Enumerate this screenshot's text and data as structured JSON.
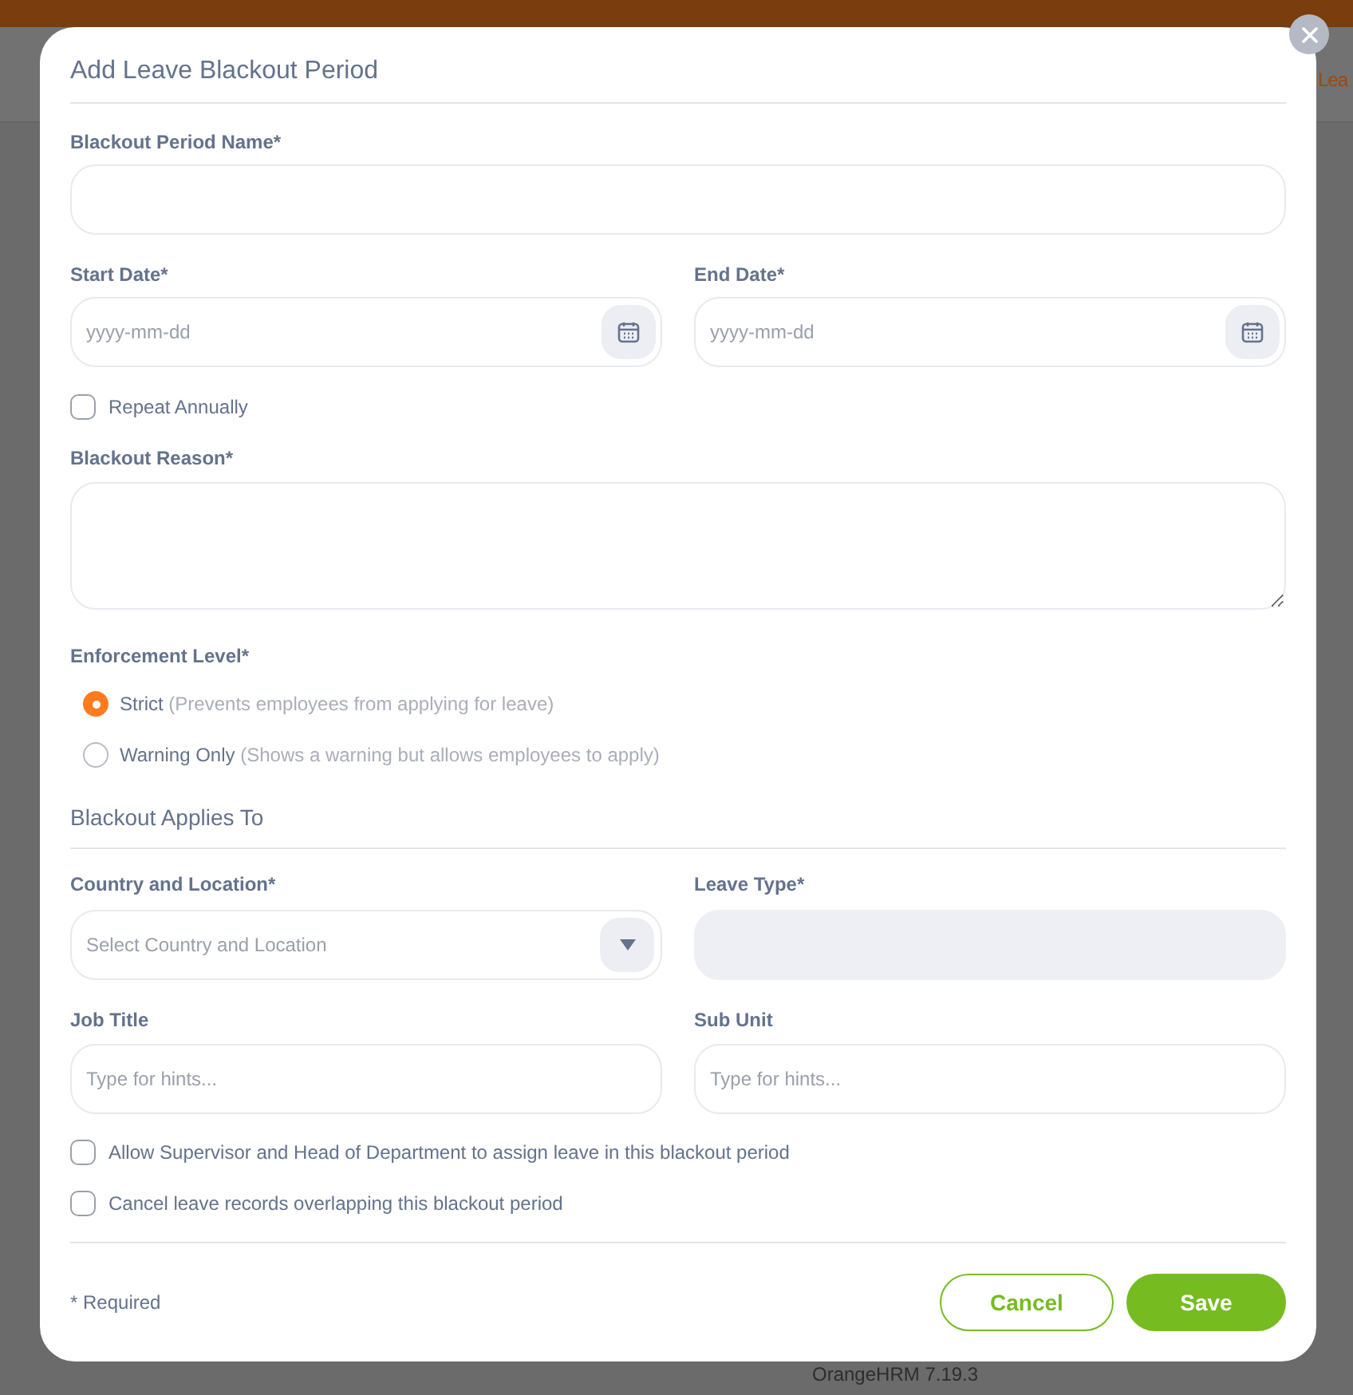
{
  "background": {
    "header_link": "Lea",
    "footer": "OrangeHRM 7.19.3"
  },
  "dialog": {
    "title": "Add Leave Blackout Period",
    "name_field": {
      "label": "Blackout Period Name*"
    },
    "start_date": {
      "label": "Start Date*",
      "placeholder": "yyyy-mm-dd"
    },
    "end_date": {
      "label": "End Date*",
      "placeholder": "yyyy-mm-dd"
    },
    "repeat_annually": {
      "label": "Repeat Annually",
      "checked": false
    },
    "reason_field": {
      "label": "Blackout Reason*"
    },
    "enforcement": {
      "label": "Enforcement Level*",
      "options": [
        {
          "label": "Strict",
          "hint": "(Prevents employees from applying for leave)",
          "selected": true
        },
        {
          "label": "Warning Only",
          "hint": "(Shows a warning but allows employees to apply)",
          "selected": false
        }
      ]
    },
    "section_title": "Blackout Applies To",
    "country": {
      "label": "Country and Location*",
      "placeholder": "Select Country and Location"
    },
    "leave_type": {
      "label": "Leave Type*",
      "disabled": true
    },
    "job_title": {
      "label": "Job Title",
      "placeholder": "Type for hints..."
    },
    "sub_unit": {
      "label": "Sub Unit",
      "placeholder": "Type for hints..."
    },
    "options": [
      {
        "label": "Allow Supervisor and Head of Department to assign leave in this blackout period",
        "checked": false
      },
      {
        "label": "Cancel leave records overlapping this blackout period",
        "checked": false
      }
    ],
    "required_note": "* Required",
    "buttons": [
      {
        "label": "Cancel",
        "kind": "secondary"
      },
      {
        "label": "Save",
        "kind": "primary"
      }
    ]
  }
}
